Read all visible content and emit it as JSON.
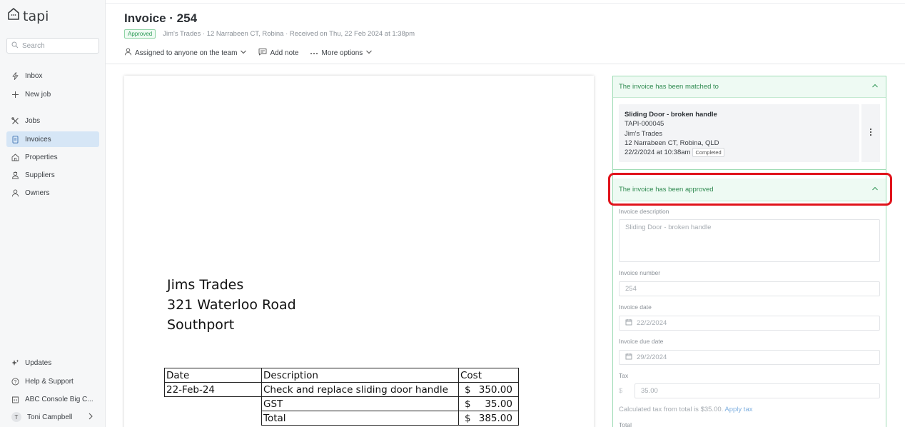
{
  "sidebar": {
    "logo_text": "tapi",
    "search_placeholder": "Search",
    "nav_top": [
      {
        "label": "Inbox",
        "icon": "lightning-icon"
      },
      {
        "label": "New job",
        "icon": "plus-icon"
      }
    ],
    "nav_main": [
      {
        "label": "Jobs",
        "icon": "tools-icon"
      },
      {
        "label": "Invoices",
        "icon": "invoice-icon",
        "active": true
      },
      {
        "label": "Properties",
        "icon": "house-icon"
      },
      {
        "label": "Suppliers",
        "icon": "supplier-icon"
      },
      {
        "label": "Owners",
        "icon": "owner-icon"
      }
    ],
    "nav_bottom": [
      {
        "label": "Updates",
        "icon": "sparkle-icon"
      },
      {
        "label": "Help & Support",
        "icon": "help-icon"
      },
      {
        "label": "ABC Console Big C...",
        "icon": "building-icon"
      }
    ],
    "user": {
      "initial": "T",
      "name": "Toni Campbell"
    }
  },
  "header": {
    "title": "Invoice · 254",
    "status_badge": "Approved",
    "subline": "Jim's Trades · 12 Narrabeen CT, Robina · Received on Thu, 22 Feb 2024 at 1:38pm",
    "actions": {
      "assigned": "Assigned to anyone on the team",
      "add_note": "Add note",
      "more_options": "More options"
    }
  },
  "document": {
    "address_lines": [
      "Jims Trades",
      "321 Waterloo Road",
      "Southport"
    ],
    "table": {
      "headers": [
        "Date",
        "Description",
        "Cost"
      ],
      "rows": [
        {
          "date": "22-Feb-24",
          "description": "Check and replace sliding door handle",
          "currency": "$",
          "amount": "350.00"
        },
        {
          "date": "",
          "description": "GST",
          "currency": "$",
          "amount": "35.00"
        },
        {
          "date": "",
          "description": "Total",
          "currency": "$",
          "amount": "385.00"
        }
      ]
    }
  },
  "panel": {
    "matched_title": "The invoice has been matched to",
    "job": {
      "title": "Sliding Door - broken handle",
      "ref": "TAPI-000045",
      "supplier": "Jim's Trades",
      "address": "12 Narrabeen CT, Robina, QLD",
      "datetime": "22/2/2024 at 10:38am",
      "status": "Completed"
    },
    "approved_title": "The invoice has been approved",
    "fields": {
      "description_label": "Invoice description",
      "description_value": "Sliding Door - broken handle",
      "number_label": "Invoice number",
      "number_value": "254",
      "date_label": "Invoice date",
      "date_value": "22/2/2024",
      "due_label": "Invoice due date",
      "due_value": "29/2/2024",
      "tax_label": "Tax",
      "tax_prefix": "$",
      "tax_value": "35.00",
      "calc_note": "Calculated tax from total is $35.00.",
      "apply_tax": "Apply tax",
      "total_label": "Total"
    }
  }
}
